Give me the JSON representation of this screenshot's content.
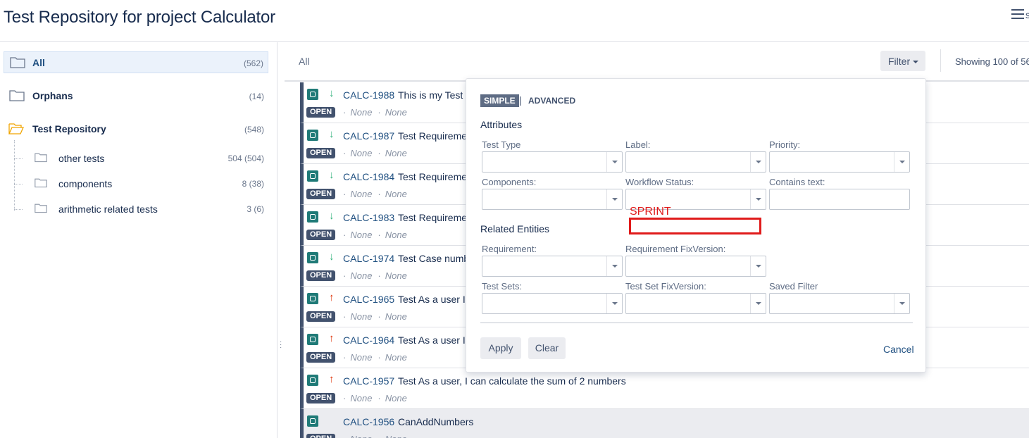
{
  "header": {
    "title": "Test Repository for project Calculator",
    "menu_trailing_text": "s"
  },
  "sidebar": {
    "items": [
      {
        "label": "All",
        "count": "(562)"
      },
      {
        "label": "Orphans",
        "count": "(14)"
      },
      {
        "label": "Test Repository",
        "count": "(548)"
      }
    ],
    "children": [
      {
        "label": "other tests",
        "count": "504 (504)"
      },
      {
        "label": "components",
        "count": "8 (38)"
      },
      {
        "label": "arithmetic related tests",
        "count": "3 (6)"
      }
    ]
  },
  "main": {
    "breadcrumb": "All",
    "filter_label": "Filter",
    "showing": "Showing 100 of 56"
  },
  "tests": [
    {
      "key": "CALC-1988",
      "summary": "This is my Test",
      "priority": "low",
      "priority_icon": "arrow-down-icon",
      "status": "OPEN",
      "meta1": "None",
      "meta2": "None"
    },
    {
      "key": "CALC-1987",
      "summary": "Test Requireme",
      "priority": "low",
      "priority_icon": "arrow-down-icon",
      "status": "OPEN",
      "meta1": "None",
      "meta2": "None"
    },
    {
      "key": "CALC-1984",
      "summary": "Test Requireme",
      "priority": "low",
      "priority_icon": "arrow-down-icon",
      "status": "OPEN",
      "meta1": "None",
      "meta2": "None"
    },
    {
      "key": "CALC-1983",
      "summary": "Test Requireme",
      "priority": "low",
      "priority_icon": "arrow-down-icon",
      "status": "OPEN",
      "meta1": "None",
      "meta2": "None"
    },
    {
      "key": "CALC-1974",
      "summary": "Test Case numb",
      "priority": "low",
      "priority_icon": "arrow-down-icon",
      "status": "OPEN",
      "meta1": "None",
      "meta2": "None"
    },
    {
      "key": "CALC-1965",
      "summary": "Test As a user I",
      "priority": "high",
      "priority_icon": "arrow-up-icon",
      "status": "OPEN",
      "meta1": "None",
      "meta2": "None"
    },
    {
      "key": "CALC-1964",
      "summary": "Test As a user I",
      "priority": "high",
      "priority_icon": "arrow-up-icon",
      "status": "OPEN",
      "meta1": "None",
      "meta2": "None"
    },
    {
      "key": "CALC-1957",
      "summary": "Test As a user, I can calculate the sum of 2 numbers",
      "priority": "high",
      "priority_icon": "arrow-up-icon",
      "status": "OPEN",
      "meta1": "None",
      "meta2": "None"
    },
    {
      "key": "CALC-1956",
      "summary": "CanAddNumbers",
      "priority": "none",
      "priority_icon": "",
      "status": "OPEN",
      "meta1": "None",
      "meta2": "None"
    }
  ],
  "filter_popup": {
    "mode_simple": "SIMPLE",
    "mode_separator": "|",
    "mode_advanced": "ADVANCED",
    "attributes_title": "Attributes",
    "test_type_label": "Test Type",
    "label_label": "Label:",
    "priority_label": "Priority:",
    "components_label": "Components:",
    "workflow_status_label": "Workflow Status:",
    "contains_text_label": "Contains text:",
    "related_title": "Related Entities",
    "requirement_label": "Requirement:",
    "requirement_fixversion_label": "Requirement FixVersion:",
    "test_sets_label": "Test Sets:",
    "test_set_fixversion_label": "Test Set FixVersion:",
    "saved_filter_label": "Saved Filter",
    "apply_label": "Apply",
    "clear_label": "Clear",
    "cancel_label": "Cancel"
  },
  "annotation": {
    "sprint_label": "SPRINT",
    "color": "#e01b1b"
  },
  "colors": {
    "link": "#205081",
    "test_type_icon": "#1f7a77",
    "status_lozenge": "#42526e",
    "priority_low": "#36b37e",
    "priority_high": "#de350b"
  }
}
